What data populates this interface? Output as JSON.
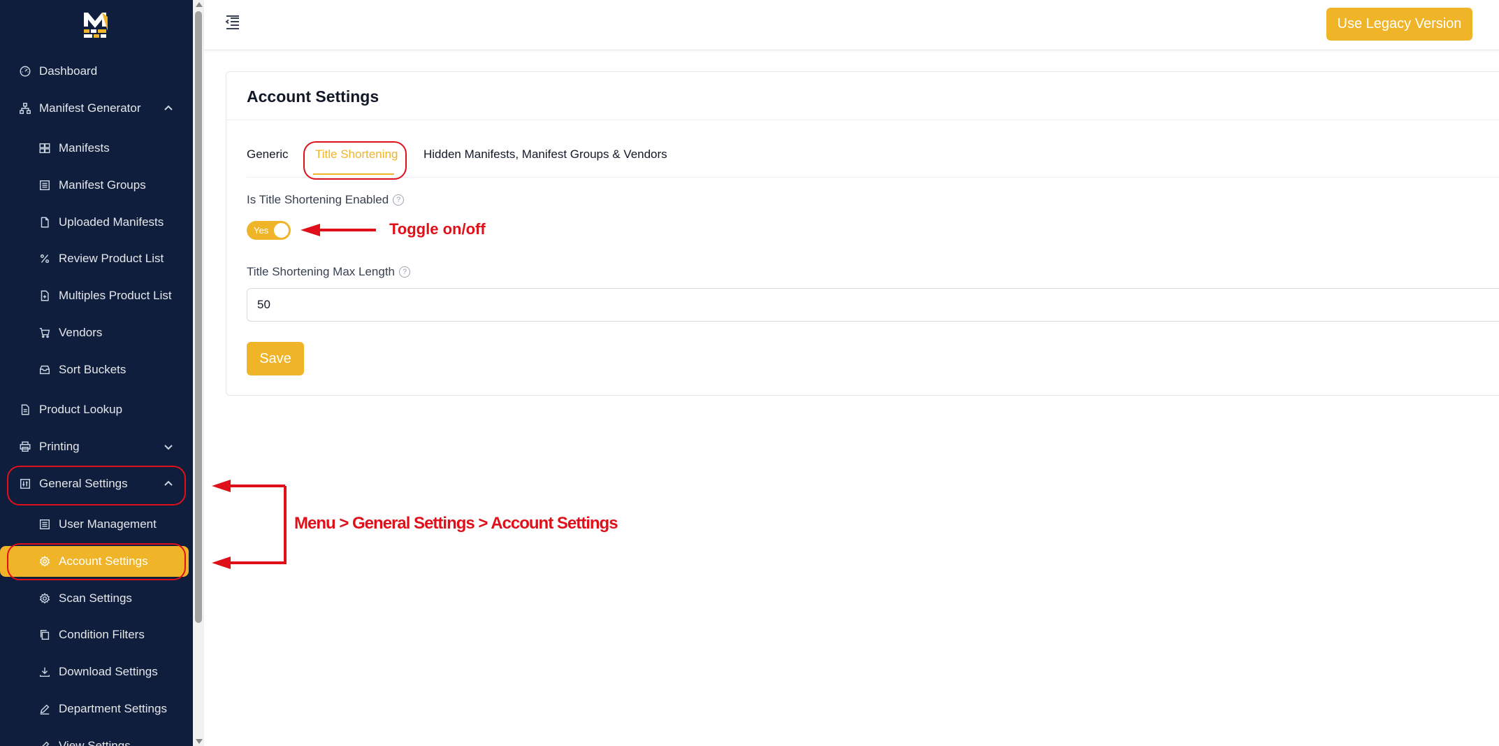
{
  "sidebar": {
    "items": [
      {
        "label": "Dashboard",
        "icon": "gauge-icon"
      },
      {
        "label": "Manifest Generator",
        "icon": "sitemap-icon"
      },
      {
        "label": "Manifests",
        "icon": "boxes-icon"
      },
      {
        "label": "Manifest Groups",
        "icon": "list-box-icon"
      },
      {
        "label": "Uploaded Manifests",
        "icon": "file-icon"
      },
      {
        "label": "Review Product List",
        "icon": "percent-icon"
      },
      {
        "label": "Multiples Product List",
        "icon": "file-plus-icon"
      },
      {
        "label": "Vendors",
        "icon": "cart-icon"
      },
      {
        "label": "Sort Buckets",
        "icon": "inbox-icon"
      },
      {
        "label": "Product Lookup",
        "icon": "document-icon"
      },
      {
        "label": "Printing",
        "icon": "printer-icon"
      },
      {
        "label": "General Settings",
        "icon": "sliders-icon"
      },
      {
        "label": "User Management",
        "icon": "list-box-icon"
      },
      {
        "label": "Account Settings",
        "icon": "gear-icon"
      },
      {
        "label": "Scan Settings",
        "icon": "gear-icon"
      },
      {
        "label": "Condition Filters",
        "icon": "copy-icon"
      },
      {
        "label": "Download Settings",
        "icon": "download-icon"
      },
      {
        "label": "Department Settings",
        "icon": "edit-icon"
      },
      {
        "label": "View Settings",
        "icon": "edit-icon"
      }
    ],
    "active": "Account Settings"
  },
  "header": {
    "legacy_button": "Use Legacy Version"
  },
  "main": {
    "title": "Account Settings",
    "tabs": [
      {
        "label": "Generic"
      },
      {
        "label": "Title Shortening"
      },
      {
        "label": "Hidden Manifests, Manifest Groups & Vendors"
      }
    ],
    "active_tab": "Title Shortening",
    "toggle_label": "Is Title Shortening Enabled",
    "toggle_text": "Yes",
    "max_length_label": "Title Shortening Max Length",
    "max_length_value": "50",
    "save_label": "Save"
  },
  "annotations": {
    "toggle_note": "Toggle on/off",
    "menu_path": "Menu > General Settings > Account Settings"
  },
  "colors": {
    "sidebar_bg": "#0f1e3d",
    "accent": "#f0b429",
    "annotation": "#e0101a"
  }
}
